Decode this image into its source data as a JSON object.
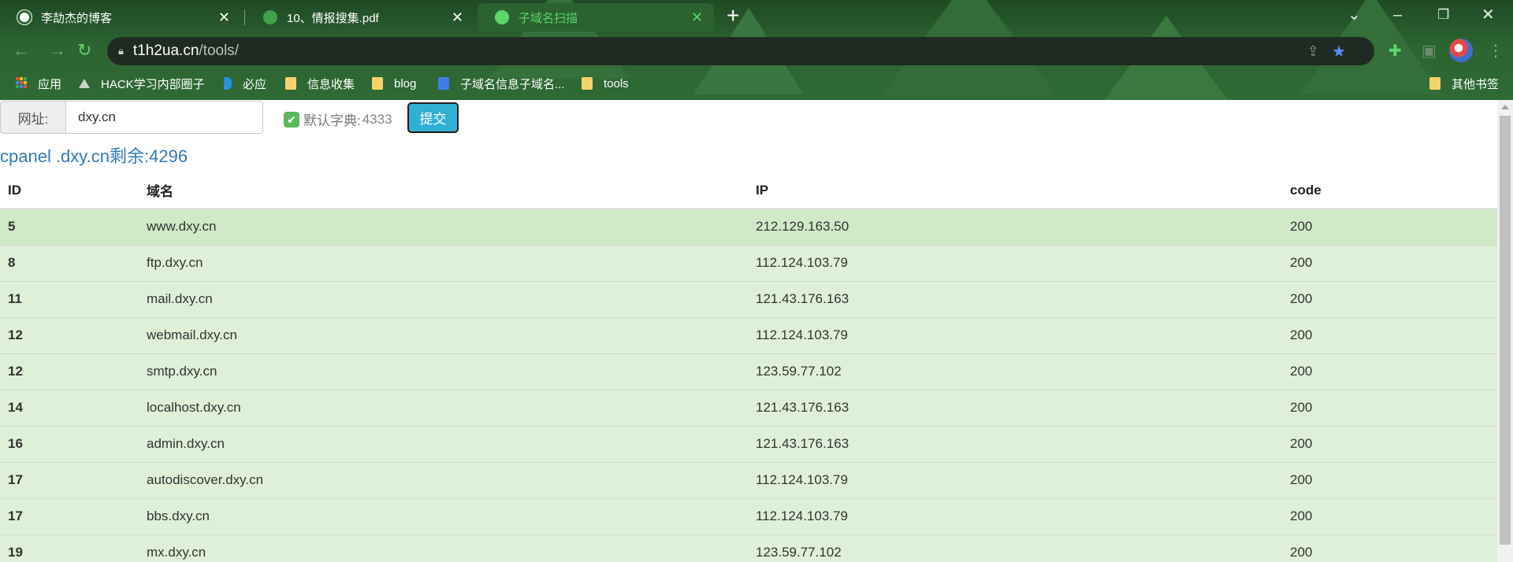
{
  "browser": {
    "tabs": [
      {
        "label": "李劼杰的博客",
        "active": false
      },
      {
        "label": "10、情报搜集.pdf",
        "active": false
      },
      {
        "label": "子域名扫描",
        "active": true
      }
    ],
    "address": {
      "host": "t1h2ua.cn",
      "path": "/tools/"
    },
    "bookmarks": [
      {
        "label": "应用",
        "icon": "apps-grid-icon"
      },
      {
        "label": "HACK学习内部圈子",
        "icon": "hack-site-icon"
      },
      {
        "label": "必应",
        "icon": "bing-icon"
      },
      {
        "label": "信息收集",
        "icon": "folder-icon"
      },
      {
        "label": "blog",
        "icon": "folder-icon"
      },
      {
        "label": "子域名信息子域名...",
        "icon": "doc-icon"
      },
      {
        "label": "tools",
        "icon": "folder-icon"
      }
    ],
    "other_bookmarks": "其他书签",
    "theme_color": "#2c6332",
    "active_tab_color": "#5bd66a"
  },
  "form": {
    "url_label": "网址:",
    "url_value": "dxy.cn",
    "dict_label": "默认字典:",
    "dict_count": "4333",
    "dict_checked": true,
    "submit_label": "提交"
  },
  "status": {
    "text": "cpanel .dxy.cn剩余:4296"
  },
  "table": {
    "headers": {
      "id": "ID",
      "domain": "域名",
      "ip": "IP",
      "code": "code"
    },
    "rows": [
      {
        "id": "5",
        "domain": "www.dxy.cn",
        "ip": "212.129.163.50",
        "code": "200"
      },
      {
        "id": "8",
        "domain": "ftp.dxy.cn",
        "ip": "112.124.103.79",
        "code": "200"
      },
      {
        "id": "11",
        "domain": "mail.dxy.cn",
        "ip": "121.43.176.163",
        "code": "200"
      },
      {
        "id": "12",
        "domain": "webmail.dxy.cn",
        "ip": "112.124.103.79",
        "code": "200"
      },
      {
        "id": "12",
        "domain": "smtp.dxy.cn",
        "ip": "123.59.77.102",
        "code": "200"
      },
      {
        "id": "14",
        "domain": "localhost.dxy.cn",
        "ip": "121.43.176.163",
        "code": "200"
      },
      {
        "id": "16",
        "domain": "admin.dxy.cn",
        "ip": "121.43.176.163",
        "code": "200"
      },
      {
        "id": "17",
        "domain": "autodiscover.dxy.cn",
        "ip": "112.124.103.79",
        "code": "200"
      },
      {
        "id": "17",
        "domain": "bbs.dxy.cn",
        "ip": "112.124.103.79",
        "code": "200"
      },
      {
        "id": "19",
        "domain": "mx.dxy.cn",
        "ip": "123.59.77.102",
        "code": "200"
      }
    ]
  },
  "colors": {
    "row_bg": "#dff0d8",
    "first_row_bg": "#d0e9c6",
    "status_text": "#337ab7",
    "submit_bg": "#31b0d5"
  }
}
